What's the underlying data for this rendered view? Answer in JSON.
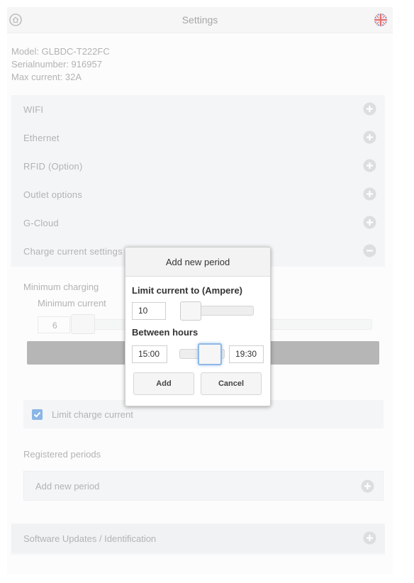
{
  "header": {
    "title": "Settings",
    "home_icon": "home-icon",
    "flag_icon": "uk-flag-icon"
  },
  "device": {
    "model": "Model: GLBDC-T222FC",
    "serial": "Serialnumber: 916957",
    "max_current": "Max current: 32A"
  },
  "sections": [
    {
      "label": "WIFI"
    },
    {
      "label": "Ethernet"
    },
    {
      "label": "RFID (Option)"
    },
    {
      "label": "Outlet options"
    },
    {
      "label": "G-Cloud"
    },
    {
      "label": "Charge current settings"
    }
  ],
  "charge_current": {
    "min_label": "Minimum charging",
    "min_sub": "Minimum current",
    "min_value": "6",
    "limit_label": "Limit charge current",
    "limit_checked": true,
    "registered_label": "Registered periods",
    "add_period_label": "Add new period"
  },
  "software": {
    "label": "Software Updates / Identification"
  },
  "dialog": {
    "title": "Add new period",
    "limit_label": "Limit current to (Ampere)",
    "limit_value": "10",
    "hours_label": "Between hours",
    "from": "15:00",
    "to": "19:30",
    "add_label": "Add",
    "cancel_label": "Cancel"
  },
  "colors": {
    "accent": "#4a90d9",
    "save_bar": "#8f8f8f"
  }
}
